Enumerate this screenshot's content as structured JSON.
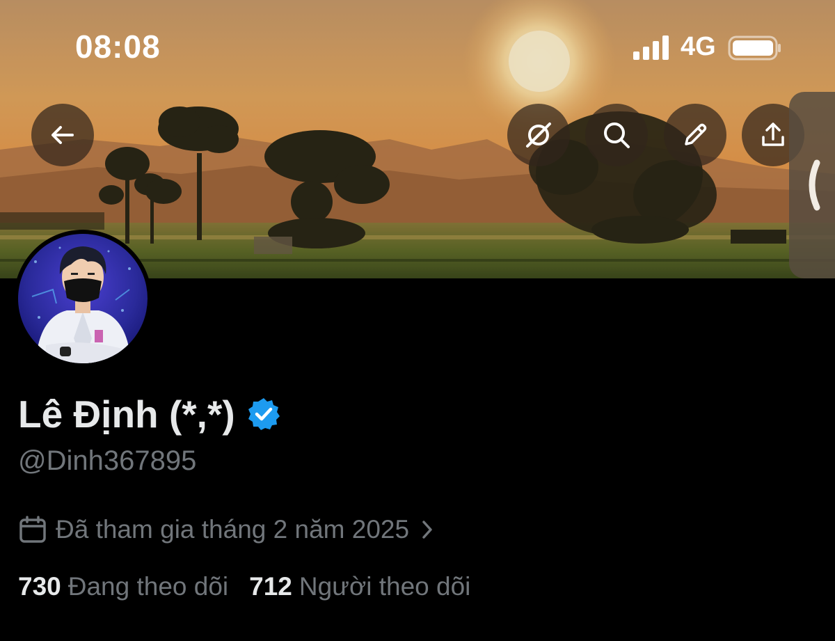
{
  "status_bar": {
    "time": "08:08",
    "network": "4G",
    "icons": [
      "signal-icon",
      "battery-icon"
    ]
  },
  "header": {
    "buttons": [
      {
        "name": "back-button",
        "icon": "arrow-left-icon"
      },
      {
        "name": "grok-button",
        "icon": "grok-icon"
      },
      {
        "name": "search-button",
        "icon": "search-icon"
      },
      {
        "name": "edit-button",
        "icon": "pencil-icon"
      },
      {
        "name": "share-button",
        "icon": "share-icon"
      }
    ],
    "side_handle_icon": "chevron-left-icon"
  },
  "profile": {
    "display_name": "Lê Định (*,*)",
    "verified": true,
    "handle": "@Dinh367895",
    "joined": "Đã tham gia tháng 2 năm 2025",
    "following_count": "730",
    "following_label": "Đang theo dõi",
    "followers_count": "712",
    "followers_label": "Người theo dõi"
  },
  "colors": {
    "background": "#000000",
    "primary_text": "#e7e9ea",
    "secondary_text": "#71767b",
    "verified_badge": "#1d9bf0"
  }
}
